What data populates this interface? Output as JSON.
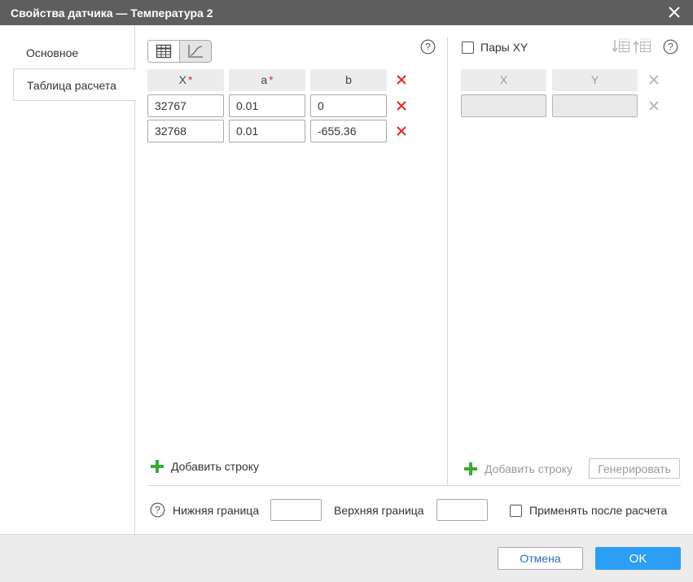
{
  "window": {
    "title": "Свойства датчика — Температура 2"
  },
  "sidebar": {
    "items": [
      {
        "label": "Основное",
        "active": false
      },
      {
        "label": "Таблица расчета",
        "active": true
      }
    ]
  },
  "table": {
    "view_modes": [
      "table-icon",
      "chart-line-icon"
    ],
    "active_view": "table-icon",
    "columns": [
      {
        "label": "X",
        "required": true
      },
      {
        "label": "a",
        "required": true
      },
      {
        "label": "b",
        "required": false
      }
    ],
    "required_mark": "*",
    "rows": [
      {
        "x": "32767",
        "a": "0.01",
        "b": "0"
      },
      {
        "x": "32768",
        "a": "0.01",
        "b": "-655.36"
      }
    ],
    "add_row_label": "Добавить строку"
  },
  "xy_pairs": {
    "checkbox_label": "Пары XY",
    "checked": false,
    "columns": [
      "X",
      "Y"
    ],
    "rows": [
      {
        "x": "",
        "y": ""
      }
    ],
    "add_row_label": "Добавить строку",
    "generate_label": "Генерировать",
    "enabled": false
  },
  "bounds": {
    "lower_label": "Нижняя граница",
    "lower_value": "",
    "upper_label": "Верхняя граница",
    "upper_value": "",
    "apply_after_label": "Применять после расчета",
    "apply_after_checked": false
  },
  "footer": {
    "cancel_label": "Отмена",
    "ok_label": "OK"
  },
  "colors": {
    "titlebar": "#5e5e5e",
    "delete_active": "#e03030",
    "delete_disabled": "#bdbdbd",
    "add_active": "#3aaa35",
    "ok_button": "#2d9ef5",
    "cancel_text": "#2a6ebd"
  }
}
